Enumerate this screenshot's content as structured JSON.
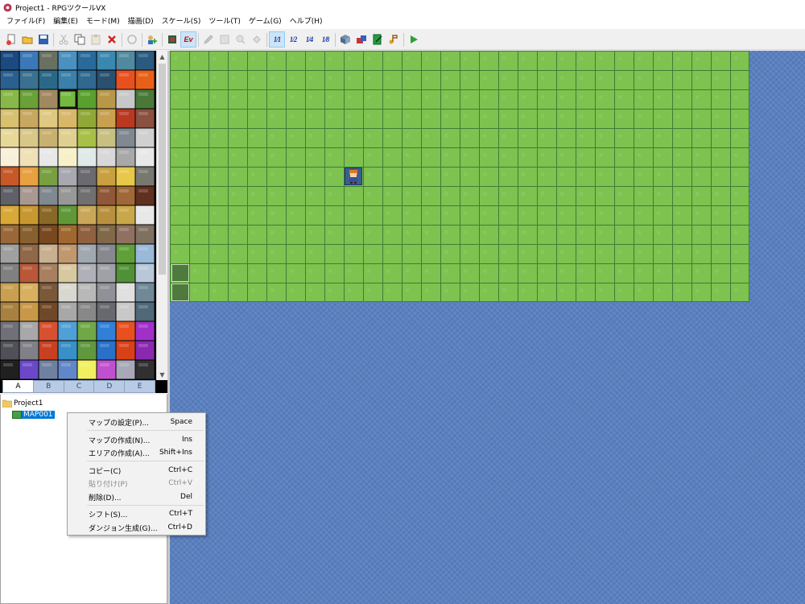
{
  "window": {
    "title": "Project1 - RPGツクールVX",
    "app_icon": "rpg-maker-icon"
  },
  "menubar": [
    "ファイル(F)",
    "編集(E)",
    "モード(M)",
    "描画(D)",
    "スケール(S)",
    "ツール(T)",
    "ゲーム(G)",
    "ヘルプ(H)"
  ],
  "toolbar": {
    "ev_label": "Ev",
    "scale_full": "1/1",
    "scale_half": "1/2",
    "scale_quarter": "1/4",
    "scale_eighth": "1/8",
    "icons": [
      "new-project-icon",
      "open-project-icon",
      "save-icon",
      "cut-icon",
      "copy-icon",
      "paste-icon",
      "delete-icon",
      "undo-icon",
      "map-layer-icon",
      "event-layer-icon",
      "pencil-icon",
      "rectangle-icon",
      "ellipse-icon",
      "fill-icon",
      "database-icon",
      "material-manager-icon",
      "script-editor-icon",
      "sound-test-icon",
      "play-test-icon"
    ]
  },
  "tileset": {
    "tabs": [
      "A",
      "B",
      "C",
      "D",
      "E"
    ],
    "active_tab": "A"
  },
  "map_tree": {
    "root": "Project1",
    "maps": [
      "MAP001"
    ],
    "selected": "MAP001"
  },
  "context_menu": {
    "items": [
      {
        "label": "マップの設定(P)...",
        "shortcut": "Space",
        "enabled": true
      },
      {
        "label": "マップの作成(N)...",
        "shortcut": "Ins",
        "enabled": true
      },
      {
        "label": "エリアの作成(A)...",
        "shortcut": "Shift+Ins",
        "enabled": true
      },
      {
        "label": "コピー(C)",
        "shortcut": "Ctrl+C",
        "enabled": true
      },
      {
        "label": "貼り付け(P)",
        "shortcut": "Ctrl+V",
        "enabled": false
      },
      {
        "label": "削除(D)...",
        "shortcut": "Del",
        "enabled": true
      },
      {
        "label": "シフト(S)...",
        "shortcut": "Ctrl+T",
        "enabled": true
      },
      {
        "label": "ダンジョン生成(G)...",
        "shortcut": "Ctrl+D",
        "enabled": true
      }
    ]
  },
  "map": {
    "columns": 30,
    "rows": 13,
    "grass_color": "#7ec250",
    "water_color": "#5a80c0",
    "event": "player-start-event"
  }
}
